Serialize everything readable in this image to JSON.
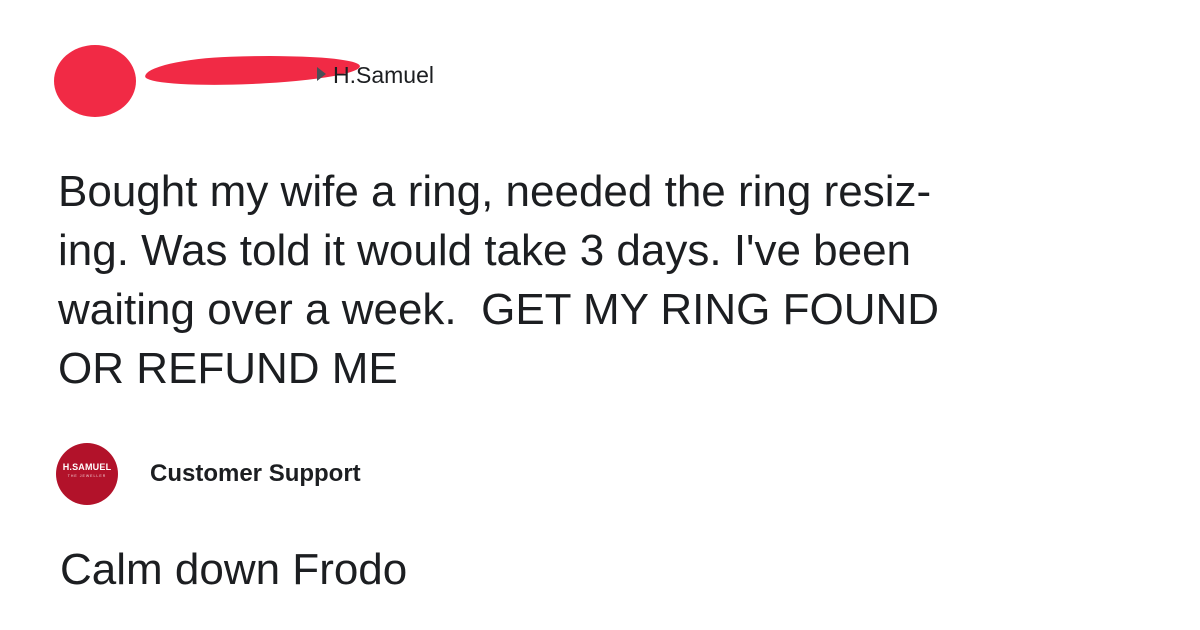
{
  "post": {
    "target_page": "H.Samuel",
    "text": "Bought my wife a ring, needed the ring resiz-ing. Was told it would take 3 days. I've been waiting over a week.  GET MY RING FOUND OR REFUND ME",
    "text_lines": [
      "Bought my wife a ring, needed the ring resiz-",
      "ing. Was told it would take 3 days. I've been",
      "waiting over a week.  GET MY RING FOUND",
      "OR REFUND ME"
    ]
  },
  "reply": {
    "logo_text": "H.SAMUEL",
    "logo_subtext": "THE JEWELLER",
    "author": "Customer Support",
    "text": "Calm down Frodo"
  },
  "colors": {
    "redaction": "#f12a45",
    "brand": "#b2122a",
    "text": "#1c1e21"
  }
}
